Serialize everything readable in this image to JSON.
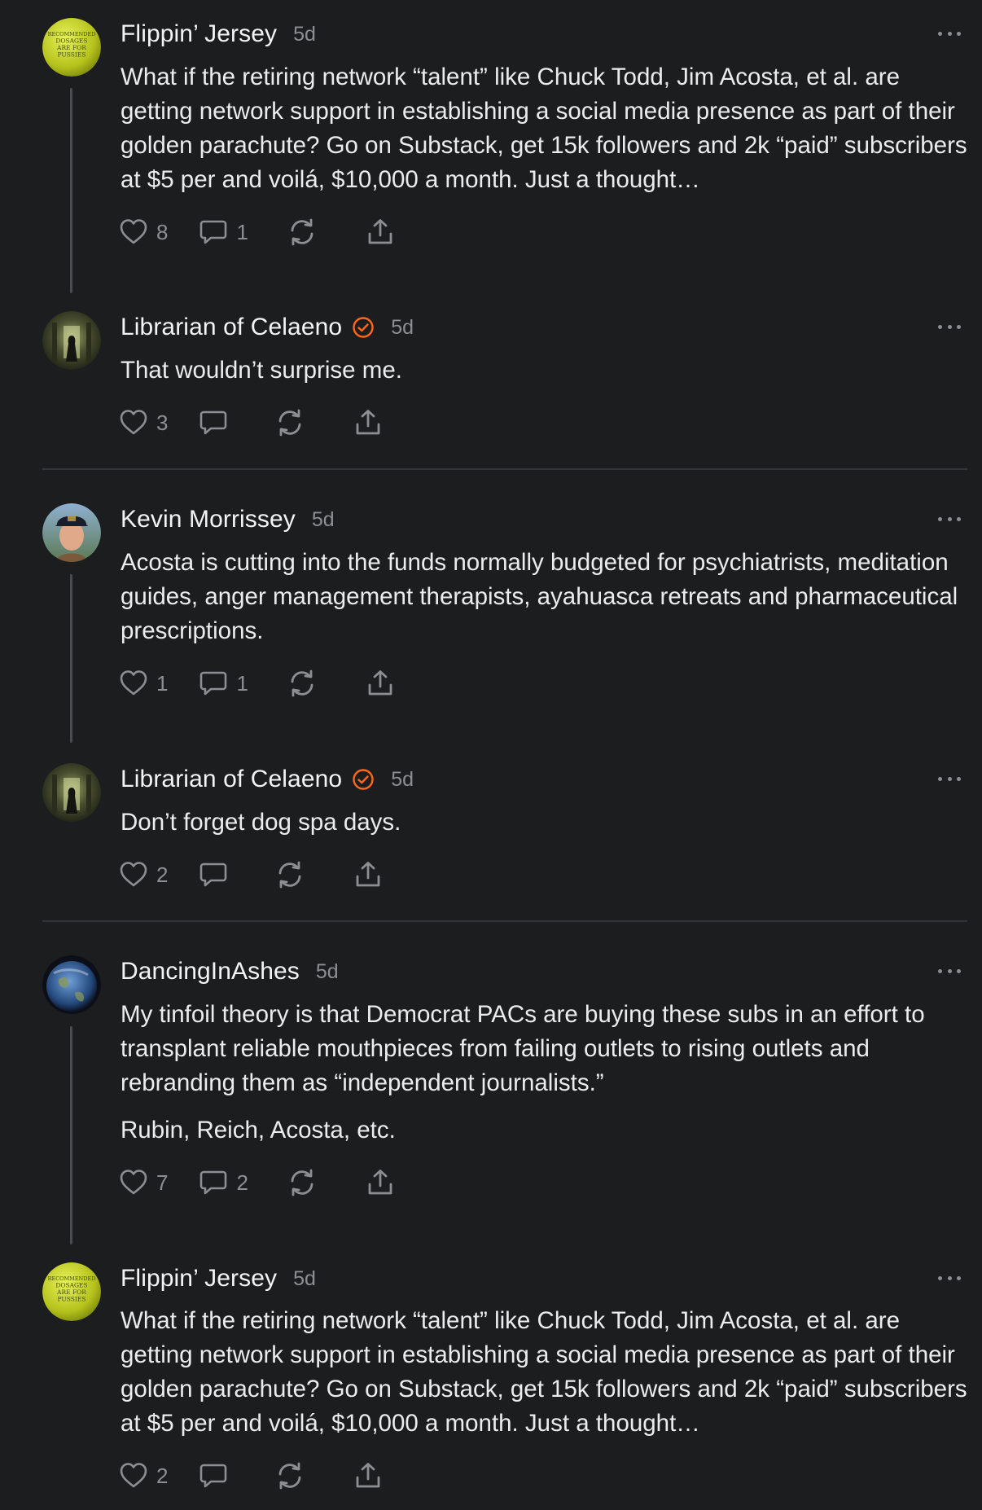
{
  "colors": {
    "background": "#1c1d1f",
    "icon": "#8d8e91",
    "verified_badge": "#ff6719"
  },
  "comments": [
    {
      "author": "Flippin’ Jersey",
      "time": "5d",
      "avatar": "badge-avatar",
      "avatar_text": "RECOMMENDED DOSAGES ARE FOR PUSSIES",
      "verified": false,
      "paragraphs": [
        "What if the retiring network “talent” like Chuck Todd, Jim Acosta, et al. are getting network support in establishing a social media presence as part of their golden parachute? Go on Substack, get 15k followers and 2k “paid” subscribers at $5 per and voilá, $10,000 a month. Just a thought…"
      ],
      "likes": "8",
      "replies": "1"
    },
    {
      "author": "Librarian of Celaeno",
      "time": "5d",
      "avatar": "library-avatar",
      "verified": true,
      "paragraphs": [
        "That wouldn’t surprise me."
      ],
      "likes": "3",
      "replies": ""
    },
    {
      "author": "Kevin Morrissey",
      "time": "5d",
      "avatar": "person-avatar",
      "verified": false,
      "paragraphs": [
        "Acosta is cutting into the funds normally budgeted for psychiatrists, meditation guides, anger management therapists, ayahuasca retreats and pharmaceutical prescriptions."
      ],
      "likes": "1",
      "replies": "1"
    },
    {
      "author": "Librarian of Celaeno",
      "time": "5d",
      "avatar": "library-avatar",
      "verified": true,
      "paragraphs": [
        "Don’t forget dog spa days."
      ],
      "likes": "2",
      "replies": ""
    },
    {
      "author": "DancingInAshes",
      "time": "5d",
      "avatar": "earth-avatar",
      "verified": false,
      "paragraphs": [
        "My tinfoil theory is that Democrat PACs are buying these subs in an effort to transplant reliable mouthpieces from failing outlets to rising outlets and rebranding them as “independent journalists.”",
        "Rubin, Reich, Acosta, etc."
      ],
      "likes": "7",
      "replies": "2"
    },
    {
      "author": "Flippin’ Jersey",
      "time": "5d",
      "avatar": "badge-avatar",
      "avatar_text": "RECOMMENDED DOSAGES ARE FOR PUSSIES",
      "verified": false,
      "paragraphs": [
        "What if the retiring network “talent” like Chuck Todd, Jim Acosta, et al. are getting network support in establishing a social media presence as part of their golden parachute? Go on Substack, get 15k followers and 2k “paid” subscribers at $5 per and voilá, $10,000 a month. Just a thought…"
      ],
      "likes": "2",
      "replies": ""
    }
  ]
}
